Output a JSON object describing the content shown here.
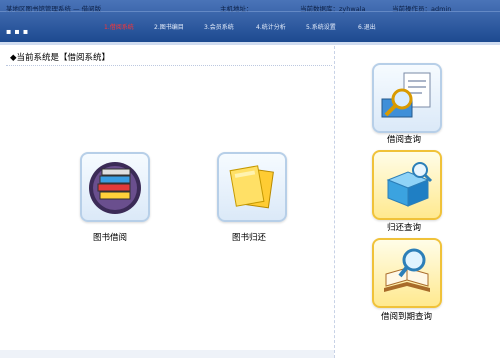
{
  "header": {
    "app_title": "某地区图书馆管理系统 — 借阅版",
    "server_label": "主机地址：",
    "db_label": "当前数据库：zyhwala",
    "user_label": "当前操作员：admin"
  },
  "nav": [
    {
      "label": "1.借阅系统"
    },
    {
      "label": "2.图书编目"
    },
    {
      "label": "3.会员系统"
    },
    {
      "label": "4.统计分析"
    },
    {
      "label": "5.系统设置"
    },
    {
      "label": "6.退出"
    }
  ],
  "page_title": "◆当前系统是【借阅系统】",
  "main_actions": {
    "borrow": "图书借阅",
    "return": "图书归还"
  },
  "side_actions": {
    "borrow_query": "借阅查询",
    "return_query": "归还查询",
    "due_query": "借阅到期查询"
  }
}
